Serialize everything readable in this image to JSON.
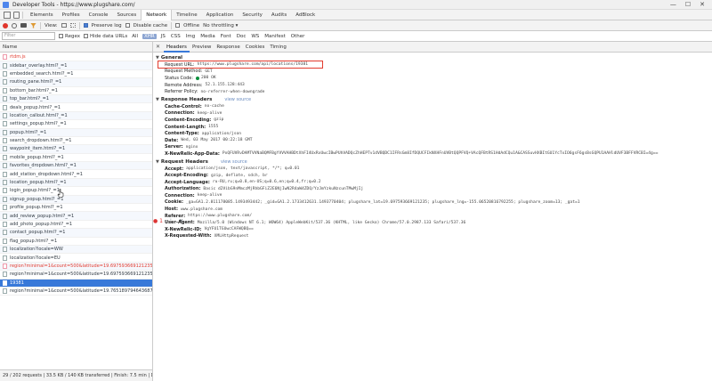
{
  "window": {
    "title": "Developer Tools - https://www.plugshare.com/",
    "buttons": [
      "—",
      "☐",
      "✕"
    ]
  },
  "devtools_tabs": [
    "Elements",
    "Profiles",
    "Console",
    "Sources",
    "Network",
    "Timeline",
    "Application",
    "Security",
    "Audits",
    "AdBlock"
  ],
  "active_tab": "Network",
  "error_count": "1",
  "network_toolbar": {
    "view_label": "View:",
    "preserve_log": "Preserve log",
    "disable_cache": "Disable cache",
    "offline": "Offline",
    "throttling": "No throttling"
  },
  "filter_bar": {
    "placeholder": "Filter",
    "regex": "Regex",
    "hide_data_urls": "Hide data URLs",
    "types": [
      "All",
      "XHR",
      "JS",
      "CSS",
      "Img",
      "Media",
      "Font",
      "Doc",
      "WS",
      "Manifest",
      "Other"
    ],
    "active_type": "XHR"
  },
  "request_list": {
    "header": "Name",
    "rows": [
      {
        "name": "rtdm.js",
        "style": "red"
      },
      {
        "name": "sidebar_overlay.html?_=1",
        "style": ""
      },
      {
        "name": "embedded_search.html?_=1",
        "style": ""
      },
      {
        "name": "routing_pane.html?_=1",
        "style": ""
      },
      {
        "name": "bottom_bar.html?_=1",
        "style": ""
      },
      {
        "name": "top_bar.html?_=1",
        "style": ""
      },
      {
        "name": "deals_popup.html?_=1",
        "style": ""
      },
      {
        "name": "location_callout.html?_=1",
        "style": ""
      },
      {
        "name": "settings_popup.html?_=1",
        "style": ""
      },
      {
        "name": "popup.html?_=1",
        "style": ""
      },
      {
        "name": "search_dropdown.html?_=1",
        "style": ""
      },
      {
        "name": "waypoint_item.html?_=1",
        "style": ""
      },
      {
        "name": "mobile_popup.html?_=1",
        "style": ""
      },
      {
        "name": "favorites_dropdown.html?_=1",
        "style": ""
      },
      {
        "name": "add_station_dropdown.html?_=1",
        "style": ""
      },
      {
        "name": "location_popup.html?_=1",
        "style": ""
      },
      {
        "name": "login_popup.html?_=1",
        "style": ""
      },
      {
        "name": "signup_popup.html?_=1",
        "style": ""
      },
      {
        "name": "profile_popup.html?_=1",
        "style": ""
      },
      {
        "name": "add_review_popup.html?_=1",
        "style": ""
      },
      {
        "name": "add_photo_popup.html?_=1",
        "style": ""
      },
      {
        "name": "contact_popup.html?_=1",
        "style": ""
      },
      {
        "name": "flag_popup.html?_=1",
        "style": ""
      },
      {
        "name": "localization?locale=WW",
        "style": ""
      },
      {
        "name": "localization?locale=EU",
        "style": ""
      },
      {
        "name": "region?minimal=1&count=500&latitude=19.697593669121235&longit...",
        "style": "red"
      },
      {
        "name": "region?minimal=1&count=500&latitude=19.697593669121235&longit...",
        "style": ""
      },
      {
        "name": "19381",
        "style": "sel"
      },
      {
        "name": "region?minimal=1&count=500&latitude=19.765189794643687&longit...",
        "style": ""
      }
    ],
    "status": "29 / 202 requests | 33.5 KB / 140 KB transferred | Finish: 7.5 min | D..."
  },
  "detail_tabs": [
    "Headers",
    "Preview",
    "Response",
    "Cookies",
    "Timing"
  ],
  "active_detail_tab": "Headers",
  "close_glyph": "✕",
  "general": {
    "title": "General",
    "rows": [
      {
        "k": "Request URL:",
        "v": "https://www.plugshare.com/api/locations/19381"
      },
      {
        "k": "Request Method:",
        "v": "GET"
      },
      {
        "k": "Status Code:",
        "v": "200 OK"
      },
      {
        "k": "Remote Address:",
        "v": "52.1.155.128:443"
      },
      {
        "k": "Referrer Policy:",
        "v": "no-referrer-when-downgrade"
      }
    ]
  },
  "response_headers": {
    "title": "Response Headers",
    "view_source": "view source",
    "rows": [
      {
        "k": "Cache-Control:",
        "v": "no-cache"
      },
      {
        "k": "Connection:",
        "v": "keep-alive"
      },
      {
        "k": "Content-Encoding:",
        "v": "gzip"
      },
      {
        "k": "Content-Length:",
        "v": "1555"
      },
      {
        "k": "Content-Type:",
        "v": "application/json"
      },
      {
        "k": "Date:",
        "v": "Wed, 03 May 2017 00:22:18 GMT"
      },
      {
        "k": "Server:",
        "v": "nginx"
      },
      {
        "k": "X-NewRelic-App-Data:",
        "v": "PxQFUVRvDAMTVVNaBQMFBgYVVVAHBDtXhFI4UxRxUwcIBwPUhVADQcZhHEPTv1dVBQDC1IFRsGm8IfDQUCFIkNXHFnUVBtQQPFVQ+VAcQFBtRS1HdAdCQu1A&CASSuvHXBItGU1YcTxIO6gsF6gsBsGQPU1AAHldUVF3BFFVRCBI=4g=="
      }
    ]
  },
  "request_headers": {
    "title": "Request Headers",
    "view_source": "view source",
    "rows": [
      {
        "k": "Accept:",
        "v": "application/json, text/javascript, */*; q=0.01"
      },
      {
        "k": "Accept-Encoding:",
        "v": "gzip, deflate, sdch, br"
      },
      {
        "k": "Accept-Language:",
        "v": "ru-RU,ru;q=0.8,en-US;q=0.6,en;q=0.4,fr;q=0.2"
      },
      {
        "k": "Authorization:",
        "v": "Basic d2VibG9nMmczMjRhbGFiZ2E6NjIwN2R4aW4ZDQ/YzJmYzkuNzcunTMwMjIj"
      },
      {
        "k": "Connection:",
        "v": "keep-alive"
      },
      {
        "k": "Cookie:",
        "v": "_ga=GA1.2.811178085.1493493442; _gid=GA1.2.1733412631.1493770404; plugshare_lat=19.697593669121235; plugshare_lng=-155.06520816792255; plugshare_zoom=13; _gat=1"
      },
      {
        "k": "Host:",
        "v": "www.plugshare.com"
      },
      {
        "k": "Referer:",
        "v": "https://www.plugshare.com/"
      },
      {
        "k": "User-Agent:",
        "v": "Mozilla/5.0 (Windows NT 6.1; WOW64) AppleWebKit/537.36 (KHTML, like Gecko) Chrome/57.0.2987.133 Safari/537.36"
      },
      {
        "k": "X-NewRelic-ID:",
        "v": "VgYFU1TGUwcCAFWQBQ=="
      },
      {
        "k": "X-Requested-With:",
        "v": "XMLHttpRequest"
      }
    ]
  },
  "colors": {
    "accent": "#3879d9",
    "error": "#e23b2e",
    "record": "#e0352b"
  }
}
